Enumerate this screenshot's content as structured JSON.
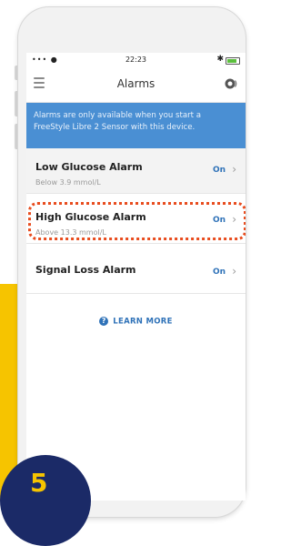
{
  "status_bar": {
    "signal": "••• ●",
    "time": "22:23",
    "bluetooth": "✱"
  },
  "header": {
    "title": "Alarms",
    "menu_icon": "hamburger-menu-icon",
    "sensor_icon": "sensor-icon"
  },
  "banner": {
    "text": "Alarms are only available when you start a FreeStyle Libre 2 Sensor with this device."
  },
  "alarms": [
    {
      "title": "Low Glucose Alarm",
      "subtitle": "Below 3.9 mmol/L",
      "status": "On"
    },
    {
      "title": "High Glucose Alarm",
      "subtitle": "Above 13.3 mmol/L",
      "status": "On"
    },
    {
      "title": "Signal Loss Alarm",
      "subtitle": "",
      "status": "On"
    }
  ],
  "learn_more": {
    "label": "LEARN MORE"
  },
  "step": {
    "number": "5"
  },
  "colors": {
    "accent": "#2f72b8",
    "banner": "#4a8fd3",
    "highlight": "#e84c1e",
    "yellow": "#f6c400",
    "navy": "#1b2a67"
  }
}
